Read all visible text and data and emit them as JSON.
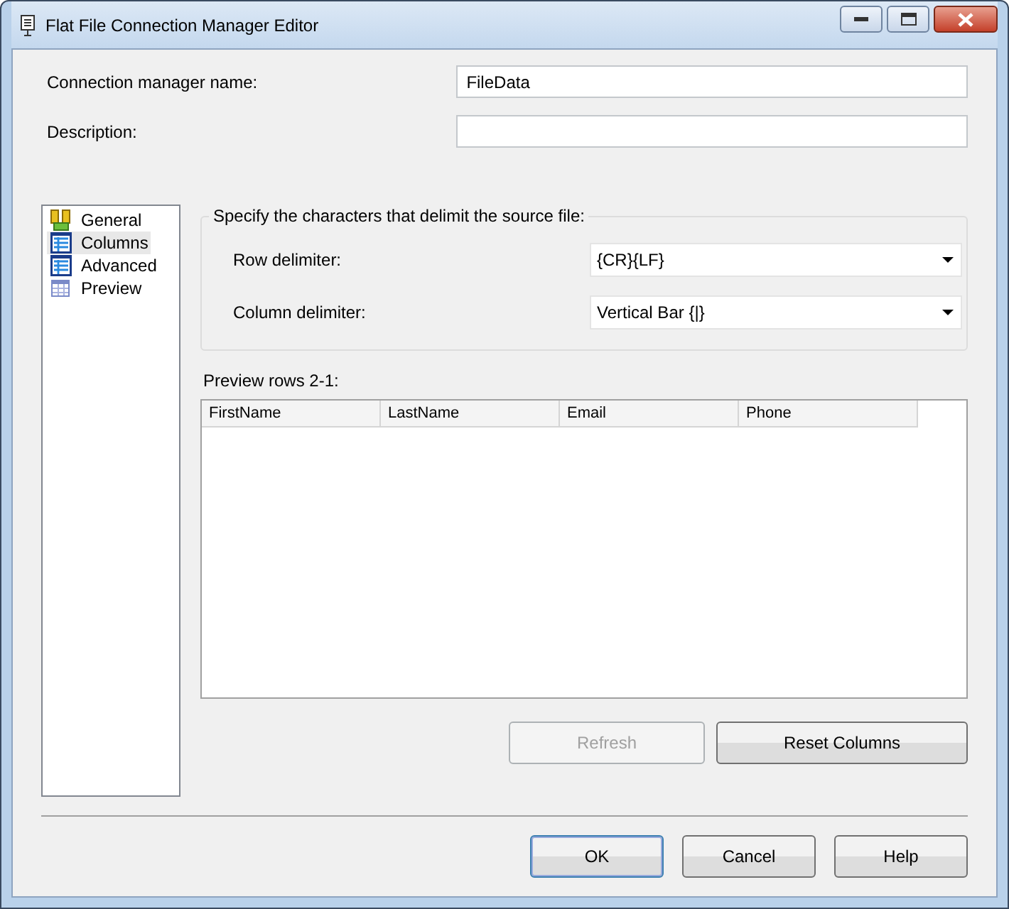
{
  "window": {
    "title": "Flat File Connection Manager Editor"
  },
  "fields": [
    {
      "label": "Connection manager name:",
      "value": "FileData"
    },
    {
      "label": "Description:"
    }
  ],
  "sidebar": {
    "items": [
      {
        "label": "General",
        "kind": "general",
        "selected": false
      },
      {
        "label": "Columns",
        "kind": "grid",
        "selected": true
      },
      {
        "label": "Advanced",
        "kind": "grid",
        "selected": false
      },
      {
        "label": "Preview",
        "kind": "preview",
        "selected": false
      }
    ]
  },
  "delimiters": {
    "title": "Specify the characters that delimit the source file:",
    "rows": [
      {
        "label": "Row delimiter:",
        "value": "{CR}{LF}"
      },
      {
        "label": "Column delimiter:",
        "value": "Vertical Bar {|}"
      }
    ]
  },
  "preview": {
    "label": "Preview rows 2-1:",
    "columns": [
      "FirstName",
      "LastName",
      "Email",
      "Phone"
    ]
  },
  "actions": [
    {
      "label": "Refresh",
      "disabled": true
    },
    {
      "label": "Reset Columns",
      "disabled": false
    }
  ],
  "buttons": [
    {
      "label": "OK",
      "default": true
    },
    {
      "label": "Cancel",
      "default": false
    },
    {
      "label": "Help",
      "default": false
    }
  ]
}
